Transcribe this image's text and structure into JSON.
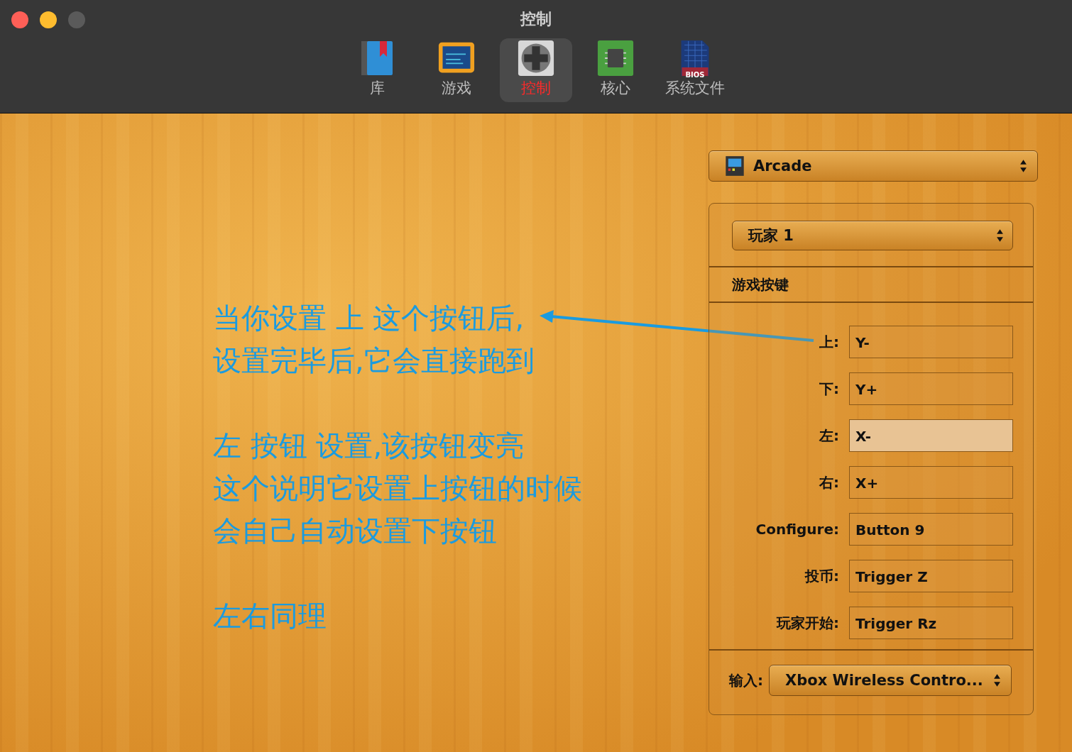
{
  "window": {
    "title": "控制"
  },
  "toolbar": [
    {
      "label": "库",
      "kind": "book",
      "selected": false
    },
    {
      "label": "游戏",
      "kind": "tv",
      "selected": false
    },
    {
      "label": "控制",
      "kind": "gamepad",
      "selected": true
    },
    {
      "label": "核心",
      "kind": "chip",
      "selected": false
    },
    {
      "label": "系统文件",
      "kind": "bios",
      "selected": false,
      "badge": "BIOS"
    }
  ],
  "annotation": {
    "paragraphs": [
      [
        "当你设置 上 这个按钮后,",
        "设置完毕后,它会直接跑到"
      ],
      [
        "左  按钮 设置,该按钮变亮",
        "这个说明它设置上按钮的时候",
        "会自己自动设置下按钮"
      ],
      [
        "左右同理"
      ]
    ]
  },
  "system_popup": {
    "value": "Arcade"
  },
  "player_popup": {
    "value": "玩家 1"
  },
  "section_title": "游戏按键",
  "bindings": [
    {
      "label": "上:",
      "value": "Y-",
      "selected": false
    },
    {
      "label": "下:",
      "value": "Y+",
      "selected": false
    },
    {
      "label": "左:",
      "value": "X-",
      "selected": true
    },
    {
      "label": "右:",
      "value": "X+",
      "selected": false
    },
    {
      "label": "Configure:",
      "value": "Button 9",
      "selected": false
    },
    {
      "label": "投币:",
      "value": "Trigger Z",
      "selected": false
    },
    {
      "label": "玩家开始:",
      "value": "Trigger Rz",
      "selected": false
    }
  ],
  "input": {
    "label": "输入:",
    "value": "Xbox Wireless Contro..."
  }
}
